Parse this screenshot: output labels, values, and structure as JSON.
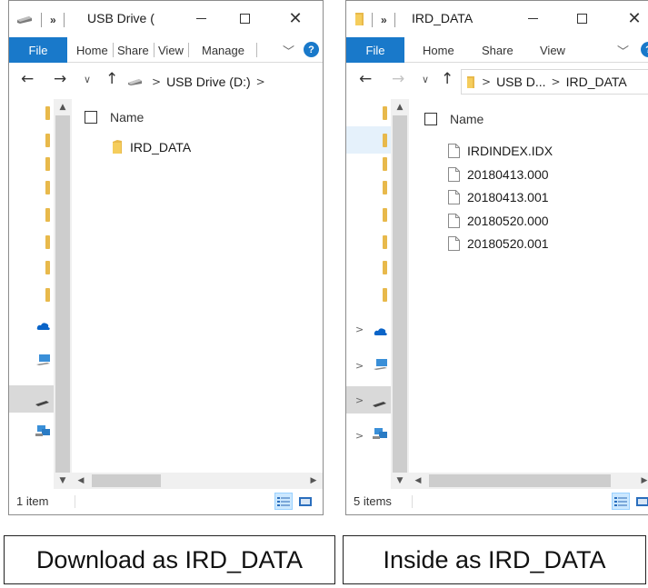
{
  "left_window": {
    "title": "USB Drive (",
    "ribbon": {
      "file": "File",
      "home": "Home",
      "share": "Share",
      "view": "View",
      "manage": "Manage",
      "help": "?"
    },
    "breadcrumb": [
      "USB Drive (D:)"
    ],
    "column_header": "Name",
    "items": [
      {
        "name": "IRD_DATA",
        "type": "folder"
      }
    ],
    "status": "1 item"
  },
  "right_window": {
    "title": "IRD_DATA",
    "ribbon": {
      "file": "File",
      "home": "Home",
      "share": "Share",
      "view": "View",
      "help": "?"
    },
    "breadcrumb": [
      "USB D...",
      "IRD_DATA"
    ],
    "column_header": "Name",
    "items": [
      {
        "name": "IRDINDEX.IDX",
        "type": "file"
      },
      {
        "name": "20180413.000",
        "type": "file"
      },
      {
        "name": "20180413.001",
        "type": "file"
      },
      {
        "name": "20180520.000",
        "type": "file"
      },
      {
        "name": "20180520.001",
        "type": "file"
      }
    ],
    "status": "5 items"
  },
  "captions": {
    "left": "Download as IRD_DATA",
    "right": "Inside as IRD_DATA"
  },
  "colors": {
    "accent": "#1979ca",
    "folder": "#e8b94b",
    "selection": "#cce8ff"
  },
  "icons": [
    "drive-icon",
    "folder-icon",
    "file-icon",
    "onedrive-icon",
    "pc-icon",
    "network-icon",
    "help-icon",
    "details-view-icon",
    "large-icons-view-icon"
  ]
}
